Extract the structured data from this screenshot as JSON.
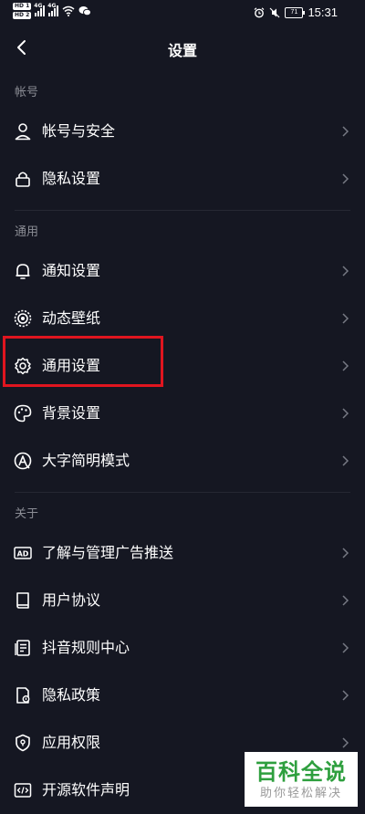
{
  "status_bar": {
    "hd1": "HD 1",
    "hd2": "HD 2",
    "net1": "4G",
    "net2": "4G",
    "battery": "71",
    "time": "15:31"
  },
  "header": {
    "title": "设置"
  },
  "sections": [
    {
      "label": "帐号",
      "items": [
        {
          "label": "帐号与安全",
          "icon": "user-icon"
        },
        {
          "label": "隐私设置",
          "icon": "lock-icon"
        }
      ]
    },
    {
      "label": "通用",
      "items": [
        {
          "label": "通知设置",
          "icon": "bell-icon"
        },
        {
          "label": "动态壁纸",
          "icon": "wallpaper-icon"
        },
        {
          "label": "通用设置",
          "icon": "gear-icon"
        },
        {
          "label": "背景设置",
          "icon": "palette-icon"
        },
        {
          "label": "大字简明模式",
          "icon": "font-size-icon"
        }
      ]
    },
    {
      "label": "关于",
      "items": [
        {
          "label": "了解与管理广告推送",
          "icon": "ad-icon"
        },
        {
          "label": "用户协议",
          "icon": "book-icon"
        },
        {
          "label": "抖音规则中心",
          "icon": "document-icon"
        },
        {
          "label": "隐私政策",
          "icon": "privacy-doc-icon"
        },
        {
          "label": "应用权限",
          "icon": "shield-icon"
        },
        {
          "label": "开源软件声明",
          "icon": "code-icon"
        }
      ]
    }
  ],
  "highlight": {
    "target": "通用设置",
    "color": "#e0151f"
  },
  "watermark": {
    "main": "百科全说",
    "sub": "助你轻松解决"
  },
  "colors": {
    "background": "#151722",
    "text": "#ffffff",
    "section_label": "#8b8d95",
    "watermark_green": "#2e9f3e"
  }
}
